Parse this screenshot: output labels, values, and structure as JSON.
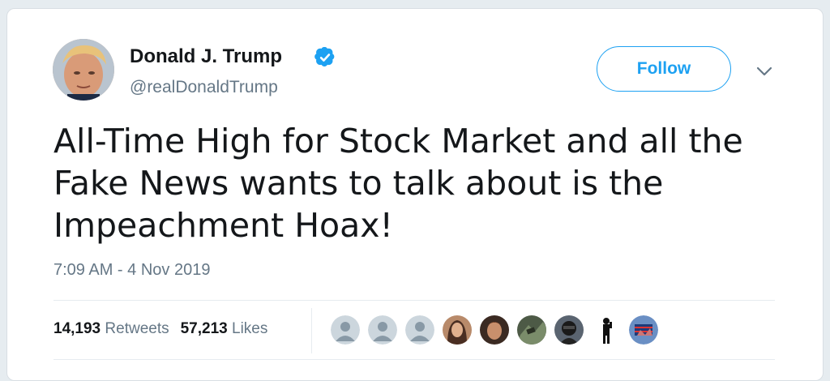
{
  "user": {
    "name": "Donald J. Trump",
    "handle": "@realDonaldTrump",
    "avatar_icon": "profile-photo",
    "verified_icon": "verified-badge-icon"
  },
  "actions": {
    "follow_label": "Follow",
    "more_icon": "chevron-down-icon"
  },
  "tweet": {
    "text": "All-Time High for Stock Market and all the Fake News wants to talk about is the Impeachment Hoax!",
    "timestamp": "7:09 AM - 4 Nov 2019"
  },
  "stats": {
    "retweets_count": "14,193",
    "retweets_label": "Retweets",
    "likes_count": "57,213",
    "likes_label": "Likes"
  },
  "likers": [
    {
      "icon": "default-avatar-icon"
    },
    {
      "icon": "default-avatar-icon"
    },
    {
      "icon": "default-avatar-icon"
    },
    {
      "icon": "user-avatar-photo"
    },
    {
      "icon": "user-avatar-photo"
    },
    {
      "icon": "user-avatar-photo"
    },
    {
      "icon": "user-avatar-photo"
    },
    {
      "icon": "user-avatar-photo"
    },
    {
      "icon": "user-avatar-photo"
    }
  ],
  "colors": {
    "accent": "#1da1f2",
    "text_primary": "#14171a",
    "text_secondary": "#657786",
    "background": "#e6ecf0"
  }
}
